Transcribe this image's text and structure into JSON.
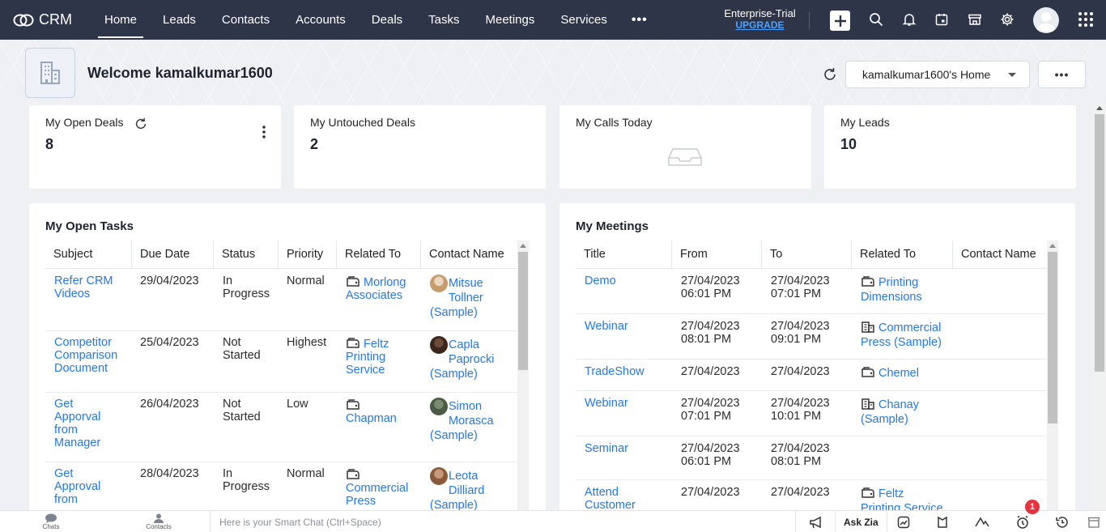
{
  "brand": {
    "name": "CRM"
  },
  "nav": {
    "tabs": [
      {
        "label": "Home",
        "active": true
      },
      {
        "label": "Leads"
      },
      {
        "label": "Contacts"
      },
      {
        "label": "Accounts"
      },
      {
        "label": "Deals"
      },
      {
        "label": "Tasks"
      },
      {
        "label": "Meetings"
      },
      {
        "label": "Services"
      }
    ],
    "more": "•••",
    "trial_label": "Enterprise-Trial",
    "upgrade_label": "UPGRADE"
  },
  "header": {
    "welcome": "Welcome kamalkumar1600",
    "home_view": "kamalkumar1600's Home",
    "more_label": "•••"
  },
  "kpis": [
    {
      "title": "My Open Deals",
      "value": "8"
    },
    {
      "title": "My Untouched Deals",
      "value": "2"
    },
    {
      "title": "My Calls Today",
      "value": ""
    },
    {
      "title": "My Leads",
      "value": "10"
    }
  ],
  "tasks": {
    "title": "My Open Tasks",
    "columns": [
      "Subject",
      "Due Date",
      "Status",
      "Priority",
      "Related To",
      "Contact Name"
    ],
    "rows": [
      {
        "subject": [
          "Refer CRM",
          "Videos"
        ],
        "due": "29/04/2023",
        "status": [
          "In",
          "Progress"
        ],
        "priority": "Normal",
        "related": [
          "Morlong",
          "Associates"
        ],
        "contact": [
          "Mitsue",
          "Tollner",
          "(Sample)"
        ]
      },
      {
        "subject": [
          "Competitor",
          "Comparison",
          "Document"
        ],
        "due": "25/04/2023",
        "status": [
          "Not",
          "Started"
        ],
        "priority": "Highest",
        "related": [
          "Feltz",
          "Printing",
          "Service"
        ],
        "contact": [
          "Capla",
          "Paprocki",
          "(Sample)"
        ]
      },
      {
        "subject": [
          "Get",
          "Apporval",
          "from",
          "Manager"
        ],
        "due": "26/04/2023",
        "status": [
          "Not",
          "Started"
        ],
        "priority": "Low",
        "related": [
          "",
          "Chapman"
        ],
        "contact": [
          "Simon",
          "Morasca",
          "(Sample)"
        ]
      },
      {
        "subject": [
          "Get",
          "Approval",
          "from"
        ],
        "due": "28/04/2023",
        "status": [
          "In",
          "Progress"
        ],
        "priority": "Normal",
        "related": [
          "",
          "Commercial",
          "Press"
        ],
        "contact": [
          "Leota",
          "Dilliard",
          "(Sample)"
        ]
      }
    ]
  },
  "meetings": {
    "title": "My Meetings",
    "columns": [
      "Title",
      "From",
      "To",
      "Related To",
      "Contact Name"
    ],
    "rows": [
      {
        "title": "Demo",
        "from": [
          "27/04/2023",
          "06:01 PM"
        ],
        "to": [
          "27/04/2023",
          "07:01 PM"
        ],
        "related": [
          "Printing",
          "Dimensions"
        ],
        "rel_icon": "deal-icon"
      },
      {
        "title": "Webinar",
        "from": [
          "27/04/2023",
          "08:01 PM"
        ],
        "to": [
          "27/04/2023",
          "09:01 PM"
        ],
        "related": [
          "Commercial",
          "Press (Sample)"
        ],
        "rel_icon": "account-icon"
      },
      {
        "title": "TradeShow",
        "from": [
          "27/04/2023"
        ],
        "to": [
          "27/04/2023"
        ],
        "related": [
          "Chemel"
        ],
        "rel_icon": "deal-icon"
      },
      {
        "title": "Webinar",
        "from": [
          "27/04/2023",
          "07:01 PM"
        ],
        "to": [
          "27/04/2023",
          "10:01 PM"
        ],
        "related": [
          "Chanay",
          "(Sample)"
        ],
        "rel_icon": "account-icon"
      },
      {
        "title": "Seminar",
        "from": [
          "27/04/2023",
          "06:01 PM"
        ],
        "to": [
          "27/04/2023",
          "08:01 PM"
        ],
        "related": [],
        "rel_icon": ""
      },
      {
        "title": [
          "Attend",
          "Customer"
        ],
        "from": [
          "27/04/2023"
        ],
        "to": [
          "27/04/2023"
        ],
        "related": [
          "Feltz",
          "Printing Service"
        ],
        "rel_icon": "deal-icon"
      }
    ]
  },
  "bottombar": {
    "chats": "Chats",
    "contacts": "Contacts",
    "smart_chat_placeholder": "Here is your Smart Chat (Ctrl+Space)",
    "ask_zia": "Ask Zia",
    "notification_count": "1"
  },
  "colors": {
    "nav_bg": "#2f3549",
    "link": "#2478e0",
    "upgrade": "#4ba3ff",
    "badge": "#e8323c"
  }
}
